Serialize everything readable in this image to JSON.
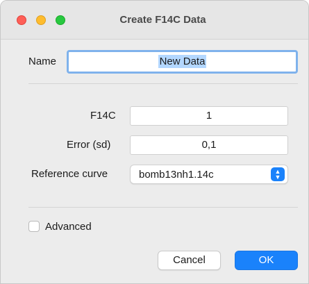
{
  "window": {
    "title": "Create F14C Data"
  },
  "form": {
    "name_label": "Name",
    "name_value": "New Data",
    "f14c_label": "F14C",
    "f14c_value": "1",
    "error_label": "Error (sd)",
    "error_value": "0,1",
    "curve_label": "Reference curve",
    "curve_value": "bomb13nh1.14c",
    "advanced_label": "Advanced",
    "advanced_checked": false
  },
  "buttons": {
    "cancel": "Cancel",
    "ok": "OK"
  },
  "colors": {
    "accent": "#1a82fb",
    "focus_ring": "#7fb2ec",
    "selection": "#b3d7ff"
  }
}
